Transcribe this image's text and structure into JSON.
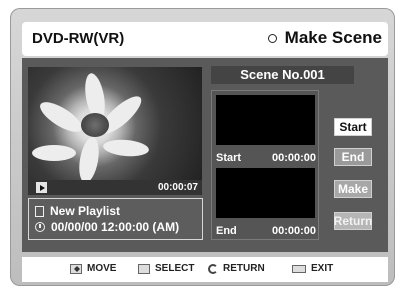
{
  "title_bar": {
    "left": "DVD-RW(VR)",
    "right": "Make Scene"
  },
  "scene_header": "Scene No.001",
  "preview": {
    "time": "00:00:07"
  },
  "info": {
    "playlist": "New Playlist",
    "datetime": "00/00/00 12:00:00 (AM)"
  },
  "scene": {
    "start_label": "Start",
    "start_time": "00:00:00",
    "end_label": "End",
    "end_time": "00:00:00"
  },
  "buttons": {
    "start": "Start",
    "end": "End",
    "make": "Make",
    "return": "Return"
  },
  "help_bar": {
    "move": "MOVE",
    "select": "SELECT",
    "return": "RETURN",
    "exit": "EXIT"
  }
}
